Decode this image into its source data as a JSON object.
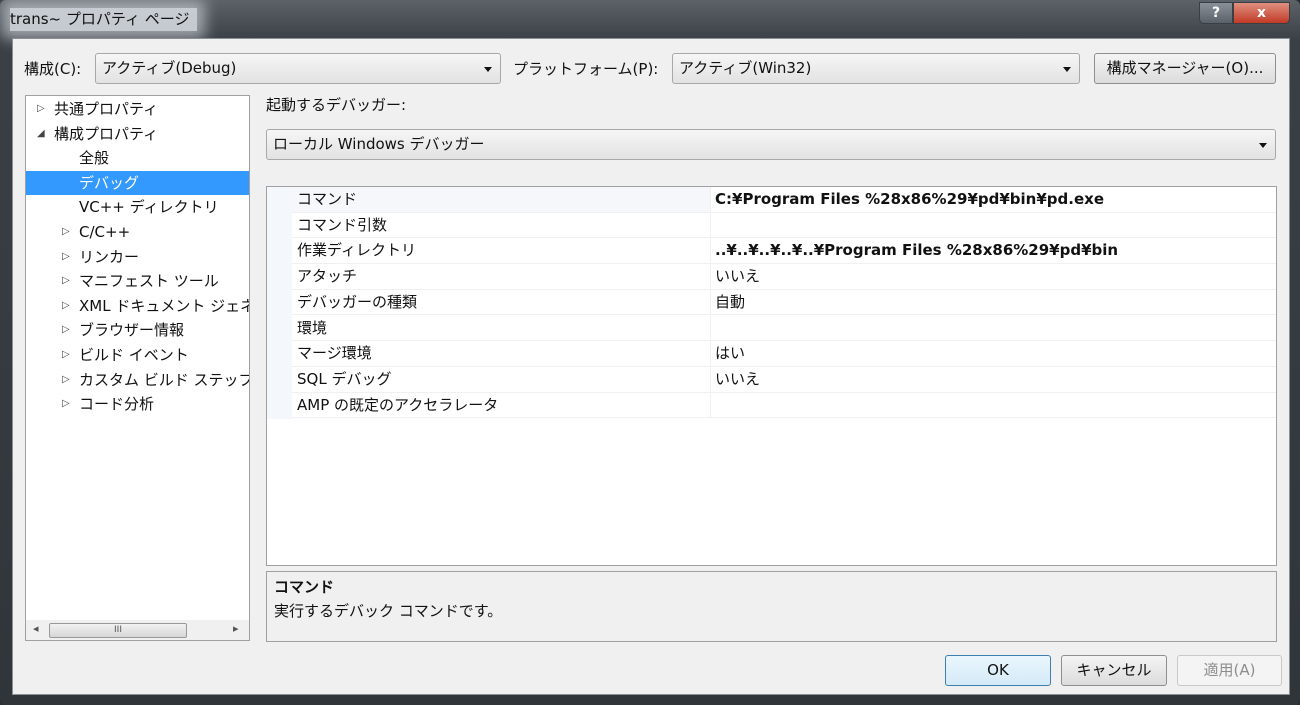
{
  "window": {
    "title": "trans~ プロパティ ページ",
    "help_label": "?",
    "close_label": "x"
  },
  "toolbar": {
    "config_label": "構成(C):",
    "config_value": "アクティブ(Debug)",
    "platform_label": "プラットフォーム(P):",
    "platform_value": "アクティブ(Win32)",
    "config_manager_label": "構成マネージャー(O)..."
  },
  "tree": {
    "items": [
      {
        "label": "共通プロパティ",
        "toggle": "▷"
      },
      {
        "label": "構成プロパティ",
        "toggle": "◢"
      },
      {
        "label": "全般",
        "toggle": ""
      },
      {
        "label": "デバッグ",
        "toggle": ""
      },
      {
        "label": "VC++ ディレクトリ",
        "toggle": ""
      },
      {
        "label": "C/C++",
        "toggle": "▷"
      },
      {
        "label": "リンカー",
        "toggle": "▷"
      },
      {
        "label": "マニフェスト ツール",
        "toggle": "▷"
      },
      {
        "label": "XML ドキュメント ジェネレーター",
        "toggle": "▷"
      },
      {
        "label": "ブラウザー情報",
        "toggle": "▷"
      },
      {
        "label": "ビルド イベント",
        "toggle": "▷"
      },
      {
        "label": "カスタム ビルド ステップ",
        "toggle": "▷"
      },
      {
        "label": "コード分析",
        "toggle": "▷"
      }
    ],
    "selected_index": 3,
    "scroll": {
      "left": "◂",
      "right": "▸",
      "grip": "III"
    }
  },
  "debugger": {
    "label": "起動するデバッガー:",
    "value": "ローカル Windows デバッガー"
  },
  "properties": [
    {
      "name": "コマンド",
      "value": "C:¥Program Files %28x86%29¥pd¥bin¥pd.exe",
      "bold": true
    },
    {
      "name": "コマンド引数",
      "value": ""
    },
    {
      "name": "作業ディレクトリ",
      "value": "..¥..¥..¥..¥..¥Program Files %28x86%29¥pd¥bin",
      "bold": true
    },
    {
      "name": "アタッチ",
      "value": "いいえ"
    },
    {
      "name": "デバッガーの種類",
      "value": "自動"
    },
    {
      "name": "環境",
      "value": ""
    },
    {
      "name": "マージ環境",
      "value": "はい"
    },
    {
      "name": "SQL デバッグ",
      "value": "いいえ"
    },
    {
      "name": "AMP の既定のアクセラレータ",
      "value": ""
    }
  ],
  "description": {
    "title": "コマンド",
    "text": "実行するデバック コマンドです。"
  },
  "buttons": {
    "ok": "OK",
    "cancel": "キャンセル",
    "apply": "適用(A)"
  }
}
